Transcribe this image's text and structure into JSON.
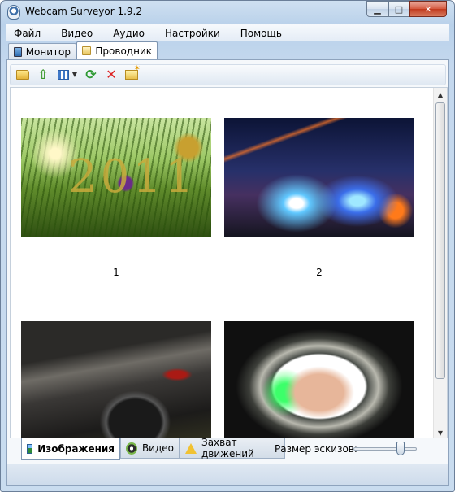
{
  "window": {
    "title": "Webcam Surveyor 1.9.2",
    "controls": {
      "minimize": "▁",
      "maximize": "□",
      "close": "✕"
    }
  },
  "menu": {
    "items": [
      {
        "label": "Файл"
      },
      {
        "label": "Видео"
      },
      {
        "label": "Аудио"
      },
      {
        "label": "Настройки"
      },
      {
        "label": "Помощь"
      }
    ]
  },
  "top_tabs": [
    {
      "label": "Монитор",
      "icon": "monitor-icon",
      "active": false
    },
    {
      "label": "Проводник",
      "icon": "folder-icon",
      "active": true
    }
  ],
  "toolbar": {
    "buttons": [
      {
        "icon": "open-folder-icon"
      },
      {
        "icon": "folder-up-icon"
      },
      {
        "icon": "view-mode-icon",
        "has_dropdown": true
      },
      {
        "icon": "refresh-icon"
      },
      {
        "icon": "delete-icon"
      },
      {
        "icon": "new-folder-icon"
      }
    ]
  },
  "gallery": {
    "items": [
      {
        "caption": "1",
        "thumb_text": "2011"
      },
      {
        "caption": "2",
        "thumb_text": ""
      },
      {
        "caption": "",
        "thumb_text": ""
      },
      {
        "caption": "",
        "thumb_text": ""
      }
    ]
  },
  "bottom_tabs": [
    {
      "label": "Изображения",
      "icon": "images-icon",
      "active": true
    },
    {
      "label": "Видео",
      "icon": "video-icon",
      "active": false
    },
    {
      "label": "Захват движений",
      "icon": "warning-icon",
      "active": false
    }
  ],
  "thumbnail_size": {
    "label": "Размер эскизов:",
    "value_fraction": 0.74
  },
  "colors": {
    "accent": "#3c6ea8",
    "close_button": "#c13a1e"
  }
}
